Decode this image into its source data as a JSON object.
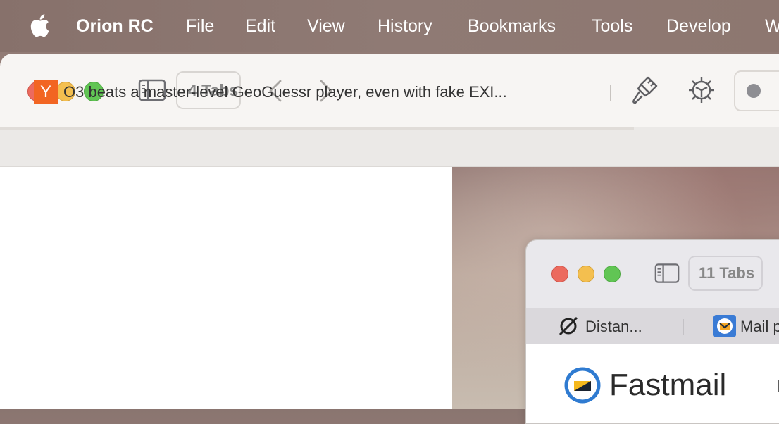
{
  "menubar": {
    "app_name": "Orion RC",
    "items": [
      "File",
      "Edit",
      "View",
      "History",
      "Bookmarks",
      "Tools",
      "Develop",
      "W"
    ]
  },
  "window_main": {
    "tabs_count": "4 Tabs",
    "active_tab": {
      "favicon_letter": "Y",
      "title": "O3 beats a master-level GeoGuessr player, even with fake EXI..."
    }
  },
  "window_second": {
    "tabs_count": "11 Tabs",
    "tabs": [
      {
        "title": "Distan..."
      },
      {
        "title": "Mail p"
      }
    ],
    "page": {
      "brand": "Fastmail",
      "extra": "I"
    }
  },
  "colors": {
    "hn_orange": "#f26522",
    "traffic_red": "#ec6a5e",
    "traffic_yellow": "#f4bf4f",
    "traffic_green": "#61c554",
    "fastmail_blue": "#2f7bd1"
  }
}
